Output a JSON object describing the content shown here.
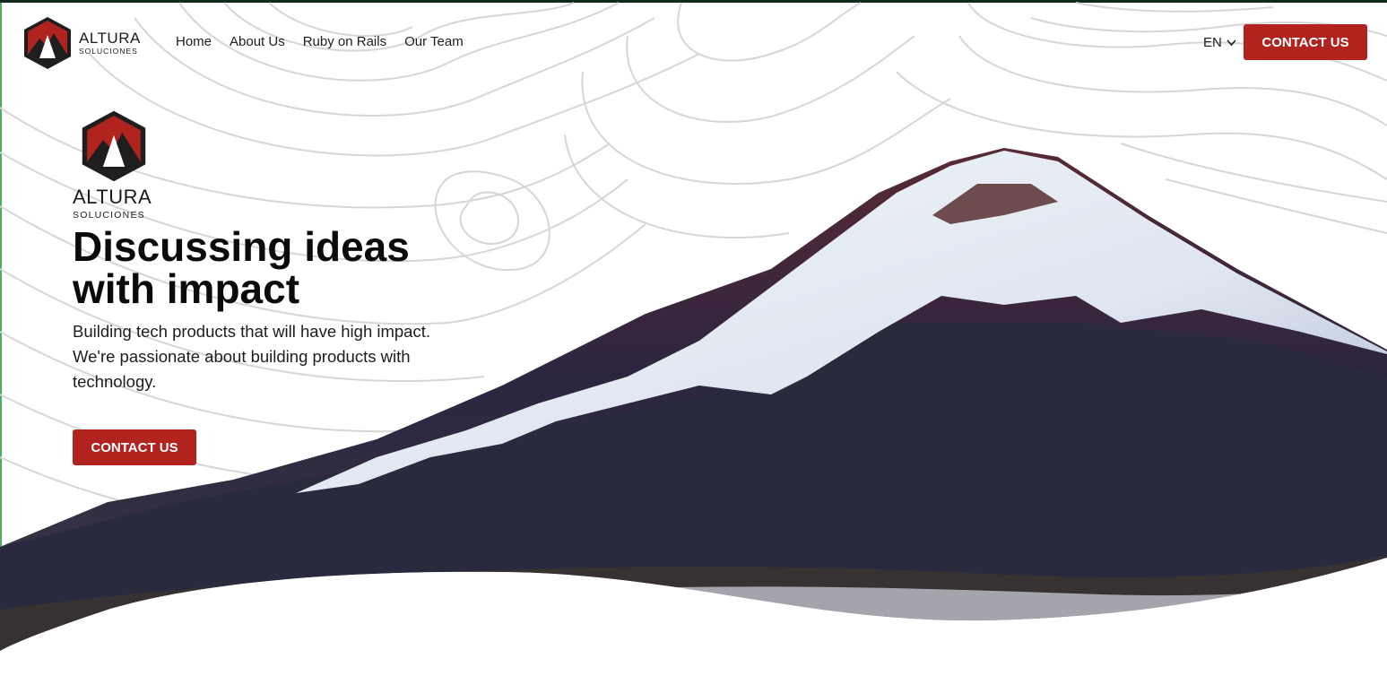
{
  "brand": {
    "name": "ALTURA",
    "tagline": "SOLUCIONES"
  },
  "nav": {
    "items": [
      "Home",
      "About Us",
      "Ruby on Rails",
      "Our Team"
    ]
  },
  "header": {
    "language": "EN",
    "language_icon": "chevron-down-icon",
    "contact_label": "CONTACT US"
  },
  "hero": {
    "logo_name": "ALTURA",
    "logo_tagline": "SOLUCIONES",
    "title": "Discussing ideas with impact",
    "description": "Building tech products that will have high impact. We're passionate about building products with technology.",
    "cta_label": "CONTACT US",
    "image": "snow-capped-mountain"
  },
  "colors": {
    "accent": "#b0231e",
    "text": "#111111",
    "background": "#ffffff"
  }
}
